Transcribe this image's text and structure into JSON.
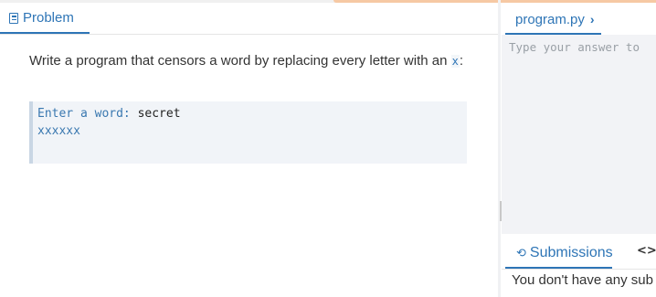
{
  "problem": {
    "tab_label": "Problem",
    "text_before": "Write a program that censors a word by replacing every letter with an ",
    "text_code": "x",
    "text_after": ":",
    "example": {
      "prompt": "Enter a word:",
      "input": " secret",
      "output": "xxxxxx"
    }
  },
  "editor": {
    "file_tab": "program.py",
    "chevron": "›",
    "placeholder": "Type your answer to"
  },
  "submissions": {
    "tab_label": "Submissions",
    "empty_text": "You don't have any sub"
  },
  "colors": {
    "accent": "#2e75b6",
    "top_accent": "#f6c9a4"
  }
}
